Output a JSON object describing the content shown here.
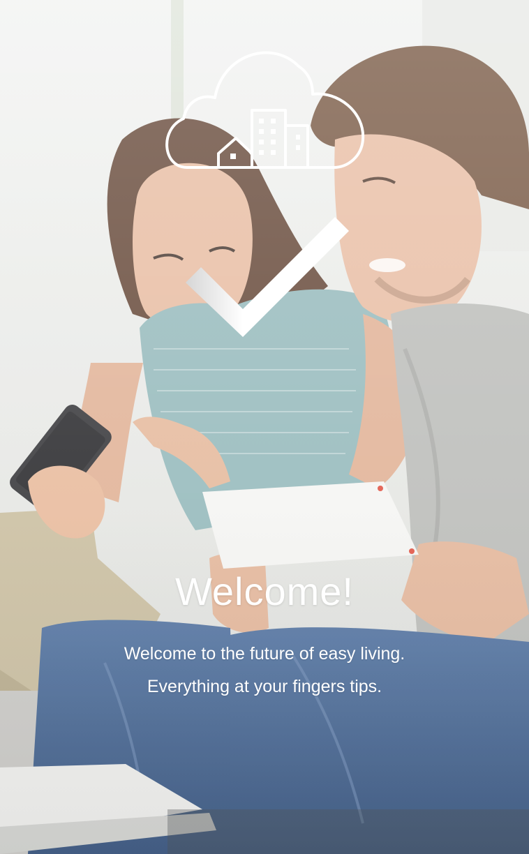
{
  "welcome": {
    "title": "Welcome!",
    "line1": "Welcome to the future of easy living.",
    "line2": "Everything at your fingers tips."
  },
  "icons": {
    "logo": "cloud-city-icon",
    "check": "checkmark-icon"
  },
  "colors": {
    "text": "#ffffff",
    "overlay": "#e9ecef"
  }
}
